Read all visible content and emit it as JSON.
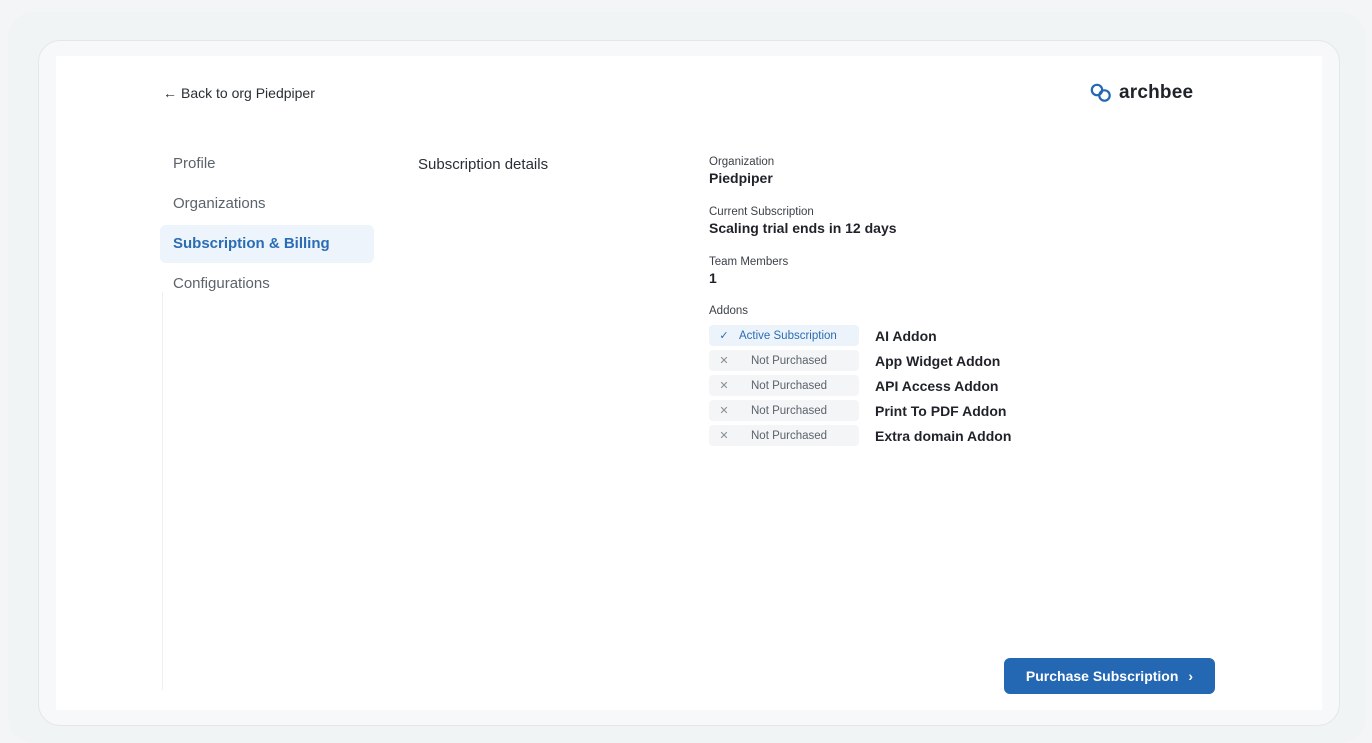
{
  "header": {
    "back_link": "Back to org Piedpiper",
    "back_icon": "arrow-left-icon",
    "logo_text": "archbee",
    "logo_icon": "archbee-logo-icon"
  },
  "sidebar": {
    "items": [
      {
        "label": "Profile",
        "active": false
      },
      {
        "label": "Organizations",
        "active": false
      },
      {
        "label": "Subscription & Billing",
        "active": true
      },
      {
        "label": "Configurations",
        "active": false
      }
    ]
  },
  "main": {
    "section_title": "Subscription details",
    "organization_label": "Organization",
    "organization_value": "Piedpiper",
    "subscription_label": "Current Subscription",
    "subscription_value": "Scaling trial ends in 12 days",
    "team_label": "Team Members",
    "team_value": "1",
    "addons_label": "Addons",
    "addons": [
      {
        "status": "Active Subscription",
        "status_icon": "check-icon",
        "name": "AI Addon"
      },
      {
        "status": "Not Purchased",
        "status_icon": "x-icon",
        "name": "App Widget Addon"
      },
      {
        "status": "Not Purchased",
        "status_icon": "x-icon",
        "name": "API Access Addon"
      },
      {
        "status": "Not Purchased",
        "status_icon": "x-icon",
        "name": "Print To PDF Addon"
      },
      {
        "status": "Not Purchased",
        "status_icon": "x-icon",
        "name": "Extra domain Addon"
      }
    ],
    "purchase_button": "Purchase Subscription",
    "purchase_icon": "chevron-right-icon"
  },
  "colors": {
    "accent": "#2467b3",
    "active_nav_bg": "#eef4fb",
    "active_nav_text": "#2a6db5"
  }
}
